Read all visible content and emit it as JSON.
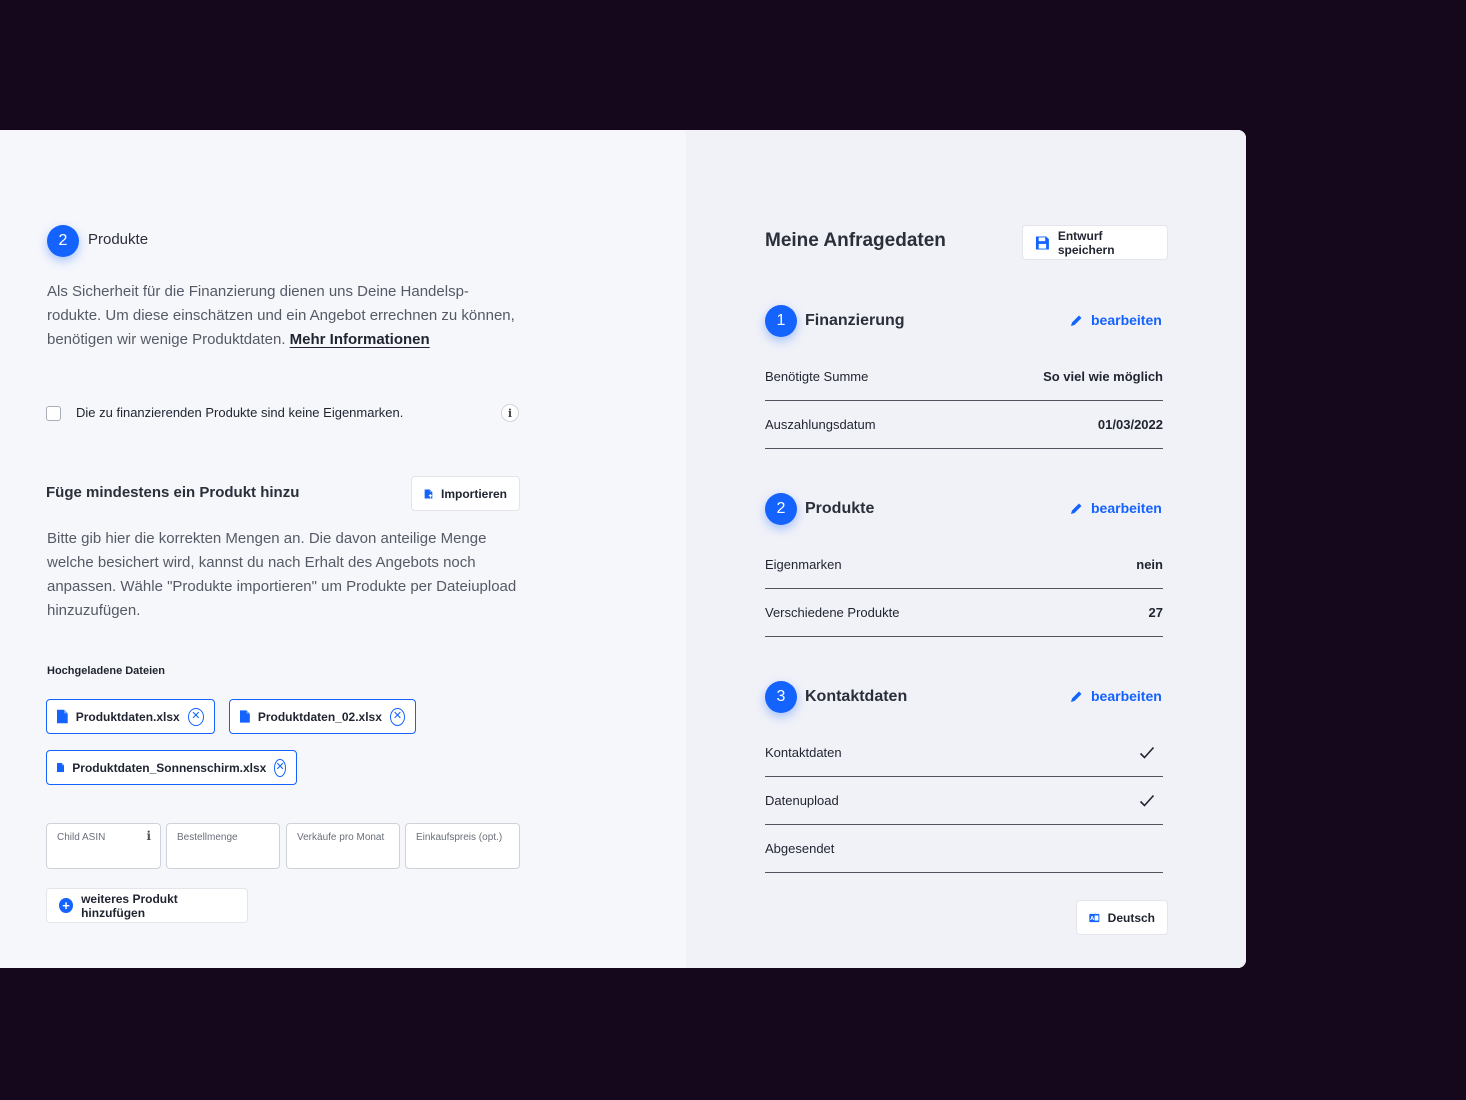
{
  "left": {
    "step_number": "2",
    "step_title": "Produkte",
    "intro_text": "Als Sicherheit für die Finanzierung dienen uns Deine Handelsp-rodukte. Um diese einschätzen und ein Angebot errechnen zu können, benötigen wir wenige Produktdaten.",
    "more_info_link": "Mehr Informationen",
    "checkbox_label": "Die zu finanzierenden Produkte sind keine Eigenmarken.",
    "info_glyph": "i",
    "add_product_title": "Füge mindestens ein Produkt hinzu",
    "import_button": "Importieren",
    "add_product_text": "Bitte gib hier die korrekten Mengen an. Die davon anteilige Menge welche besichert wird, kannst du nach Erhalt des Angebots noch anpassen. Wähle \"Produkte importieren\" um Produkte per Dateiupload hinzuzufügen.",
    "uploaded_files_label": "Hochgeladene Dateien",
    "files": [
      {
        "name": "Produktdaten.xlsx"
      },
      {
        "name": "Produktdaten_02.xlsx"
      },
      {
        "name": "Produktdaten_Sonnenschirm.xlsx"
      }
    ],
    "fields": [
      {
        "placeholder": "Child ASIN"
      },
      {
        "placeholder": "Bestellmenge"
      },
      {
        "placeholder": "Verkäufe pro Monat"
      },
      {
        "placeholder": "Einkaufspreis (opt.)"
      }
    ],
    "add_more_button": "weiteres Produkt hinzufügen"
  },
  "right": {
    "title": "Meine Anfragedaten",
    "save_draft_button": "Entwurf speichern",
    "edit_label": "bearbeiten",
    "sections": [
      {
        "number": "1",
        "title": "Finanzierung",
        "rows": [
          {
            "label": "Benötigte Summe",
            "value": "So viel wie möglich"
          },
          {
            "label": "Auszahlungsdatum",
            "value": "01/03/2022"
          }
        ]
      },
      {
        "number": "2",
        "title": "Produkte",
        "rows": [
          {
            "label": "Eigenmarken",
            "value": "nein"
          },
          {
            "label": "Verschiedene Produkte",
            "value": "27"
          }
        ]
      },
      {
        "number": "3",
        "title": "Kontaktdaten",
        "rows": [
          {
            "label": "Kontaktdaten",
            "icon": "check-icon"
          },
          {
            "label": "Datenupload",
            "icon": "check-icon"
          },
          {
            "label": "Abgesendet"
          }
        ]
      }
    ],
    "language_button": "Deutsch"
  },
  "colors": {
    "accent": "#1463ff",
    "background": "#16081c",
    "panel_left": "#f6f7fb",
    "panel_right": "#f1f2f8"
  }
}
